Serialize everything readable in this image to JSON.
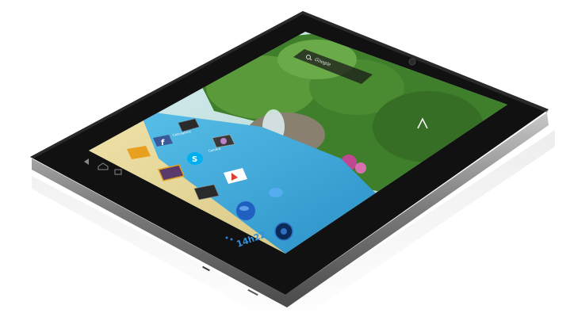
{
  "device": {
    "bezel_color": "#111111",
    "frame_color": "#8c8c8c"
  },
  "search": {
    "placeholder": "Google"
  },
  "status_bar": {
    "time": "14h22"
  },
  "apps": [
    {
      "label": "Calculatrice",
      "icon": "calculator-icon",
      "color": "#2a2a2a"
    },
    {
      "label": "Caméra",
      "icon": "camera-icon",
      "color": "#3a3a3a"
    },
    {
      "label": "",
      "icon": "facebook-icon",
      "color": "#3b5998"
    },
    {
      "label": "",
      "icon": "folder-icon",
      "color": "#e8a020"
    },
    {
      "label": "",
      "icon": "skype-icon",
      "color": "#00aff0"
    },
    {
      "label": "",
      "icon": "gallery-icon",
      "color": "#5a3a6a"
    },
    {
      "label": "",
      "icon": "play-store-icon",
      "color": "#ffffff"
    },
    {
      "label": "",
      "icon": "settings-icon",
      "color": "#2a2a2a"
    },
    {
      "label": "",
      "icon": "twitter-icon",
      "color": "#55acee"
    },
    {
      "label": "",
      "icon": "browser-icon",
      "color": "#2060c0"
    },
    {
      "label": "",
      "icon": "music-icon",
      "color": "#0a2a5a"
    }
  ],
  "nav_buttons": [
    "back-icon",
    "home-icon",
    "recents-icon"
  ],
  "colors": {
    "sky": "#cfe8f0",
    "pool": "#3aa8d8",
    "sand": "#e8d898",
    "foliage": "#3a7a2a"
  }
}
